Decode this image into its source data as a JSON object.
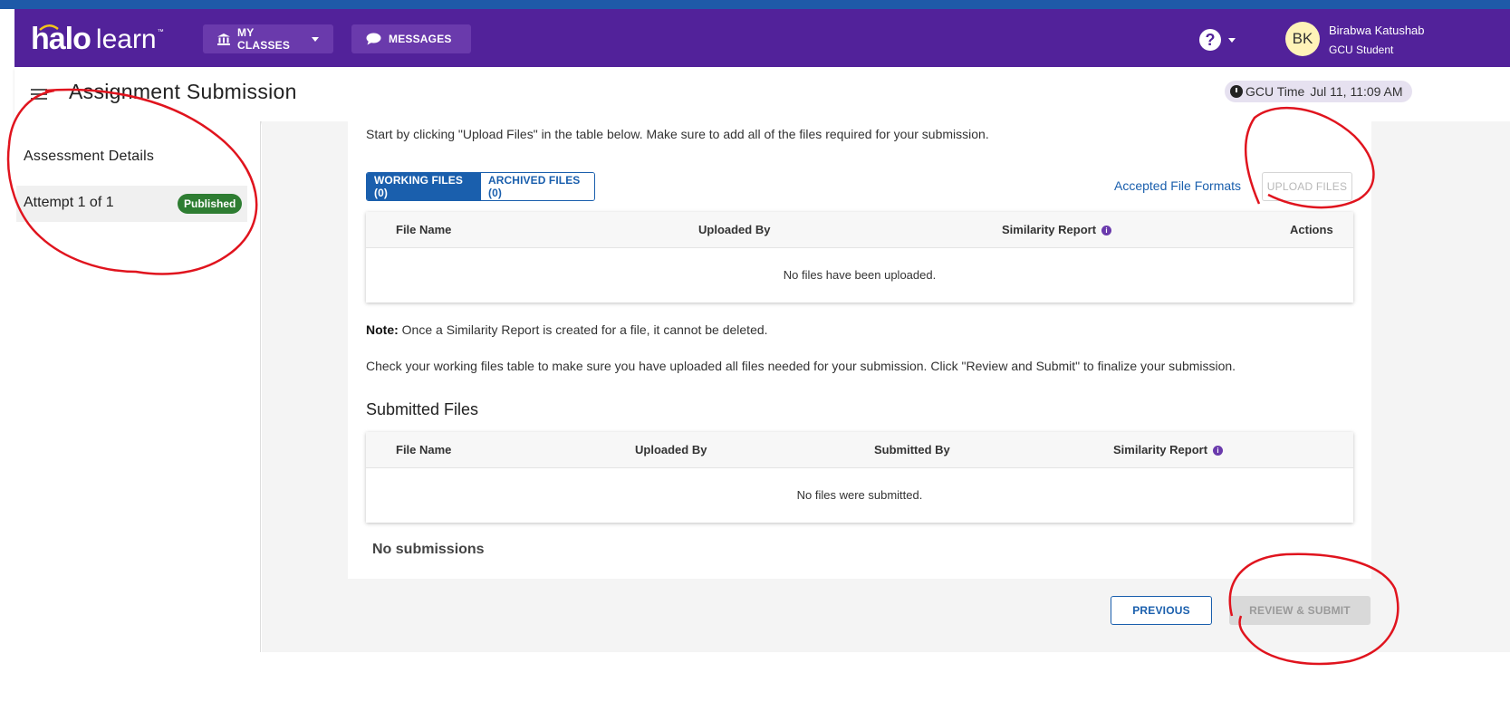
{
  "header": {
    "logo_main": "halo",
    "logo_secondary": "learn",
    "logo_tm": "™",
    "my_classes_label": "MY CLASSES",
    "messages_label": "MESSAGES",
    "help_symbol": "?",
    "avatar_initials": "BK",
    "user_name": "Birabwa Katushab",
    "user_role": "GCU Student"
  },
  "subheader": {
    "page_title": "Assignment Submission",
    "time_label": "GCU Time",
    "time_value": "Jul 11, 11:09 AM"
  },
  "sidebar": {
    "details_label": "Assessment Details",
    "attempt_label": "Attempt 1 of 1",
    "attempt_status": "Published"
  },
  "main": {
    "intro": "Start by clicking \"Upload Files\" in the table below. Make sure to add all of the files required for your submission.",
    "tab_working": "WORKING FILES (0)",
    "tab_archived": "ARCHIVED FILES (0)",
    "formats_link": "Accepted File Formats",
    "upload_label": "UPLOAD FILES",
    "working_table": {
      "col_file_name": "File Name",
      "col_uploaded_by": "Uploaded By",
      "col_similarity": "Similarity Report",
      "col_actions": "Actions",
      "empty_text": "No files have been uploaded."
    },
    "note_label": "Note:",
    "note_text": " Once a Similarity Report is created for a file, it cannot be deleted.",
    "check_text": "Check your working files table to make sure you have uploaded all files needed for your submission. Click \"Review and Submit\" to finalize your submission.",
    "submitted_heading": "Submitted Files",
    "submitted_table": {
      "col_file_name": "File Name",
      "col_uploaded_by": "Uploaded By",
      "col_submitted_by": "Submitted By",
      "col_similarity": "Similarity Report",
      "empty_text": "No files were submitted."
    },
    "no_submissions": "No submissions",
    "info_symbol": "i"
  },
  "footer": {
    "previous_label": "PREVIOUS",
    "review_label": "REVIEW & SUBMIT"
  },
  "colors": {
    "brand_purple": "#52229a",
    "link_blue": "#1a5fad",
    "published_green": "#2e7d32",
    "annotation_red": "#e0141e"
  }
}
